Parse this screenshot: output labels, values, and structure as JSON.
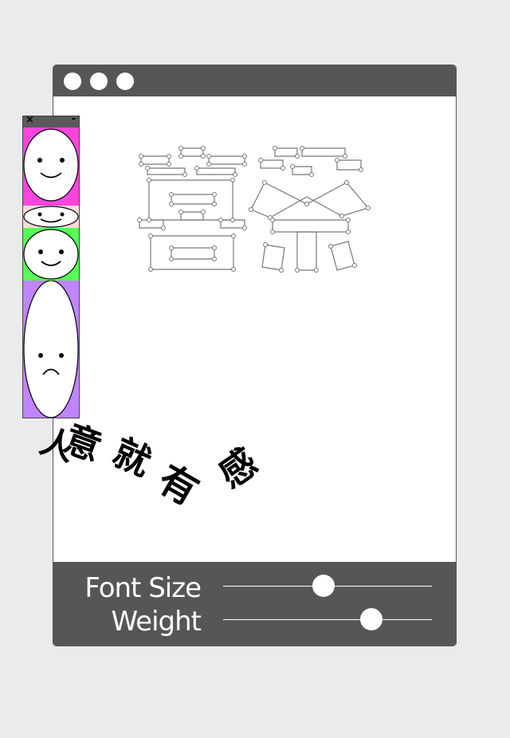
{
  "window": {
    "traffic_lights": [
      "window-button-1",
      "window-button-2",
      "window-button-3"
    ]
  },
  "canvas": {
    "outlined_glyphs": "囍蔡",
    "rotated_text": [
      "意",
      "就",
      "有",
      "感"
    ],
    "cut_off_glyph": "人"
  },
  "controls": {
    "font_size_label": "Font Size",
    "weight_label": "Weight",
    "font_size_value": 0.48,
    "weight_value": 0.71
  },
  "faces_window": {
    "close_label": "×",
    "minimize_label": "-",
    "panels": [
      {
        "color": "#ff44dd",
        "expression": "smile"
      },
      {
        "color": "#ffd9d9",
        "expression": "smile"
      },
      {
        "color": "#55ff55",
        "expression": "smile"
      },
      {
        "color": "#c084ff",
        "expression": "frown"
      }
    ]
  },
  "colors": {
    "background": "#ebebeb",
    "chrome": "#565656",
    "canvas": "#ffffff",
    "text_dark": "#000000",
    "control_text": "#ffffff"
  }
}
